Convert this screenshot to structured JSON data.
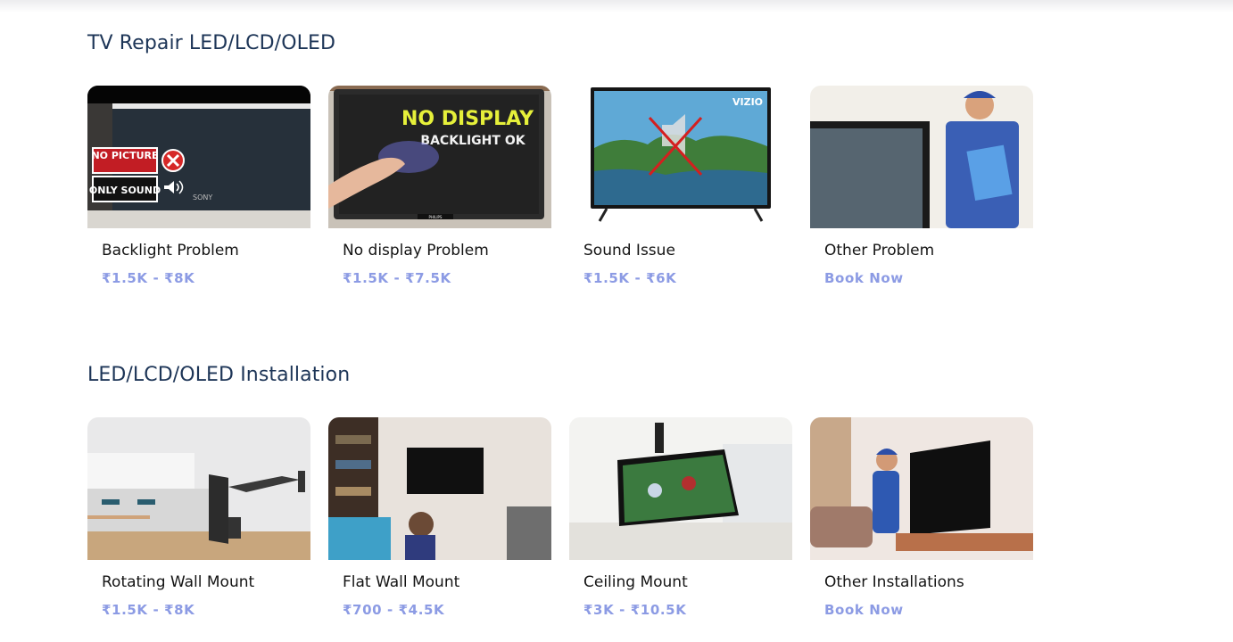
{
  "sections": [
    {
      "title": "TV Repair LED/LCD/OLED",
      "cards": [
        {
          "title": "Backlight Problem",
          "price": "₹1.5K - ₹8K",
          "image_icon": "tv-no-picture-icon",
          "image_text": {
            "badge1": "NO PICTURE",
            "badge2": "ONLY SOUND",
            "brand": "SONY"
          }
        },
        {
          "title": "No display Problem",
          "price": "₹1.5K - ₹7.5K",
          "image_icon": "tv-no-display-icon",
          "image_text": {
            "line1": "NO DISPLAY",
            "line2": "BACKLIGHT OK",
            "brand": "PHILIPS"
          }
        },
        {
          "title": "Sound Issue",
          "price": "₹1.5K - ₹6K",
          "image_icon": "tv-muted-icon",
          "image_text": {
            "brand": "VIZIO"
          }
        },
        {
          "title": "Other Problem",
          "price": "Book Now",
          "image_icon": "technician-icon"
        }
      ]
    },
    {
      "title": "LED/LCD/OLED Installation",
      "cards": [
        {
          "title": "Rotating Wall Mount",
          "price": "₹1.5K - ₹8K",
          "image_icon": "rotating-mount-icon"
        },
        {
          "title": "Flat Wall Mount",
          "price": "₹700 - ₹4.5K",
          "image_icon": "flat-mount-icon"
        },
        {
          "title": "Ceiling Mount",
          "price": "₹3K - ₹10.5K",
          "image_icon": "ceiling-mount-icon"
        },
        {
          "title": "Other Installations",
          "price": "Book Now",
          "image_icon": "installer-icon"
        }
      ]
    }
  ],
  "colors": {
    "heading": "#1d3557",
    "title": "#141414",
    "price": "#8c9be4"
  }
}
